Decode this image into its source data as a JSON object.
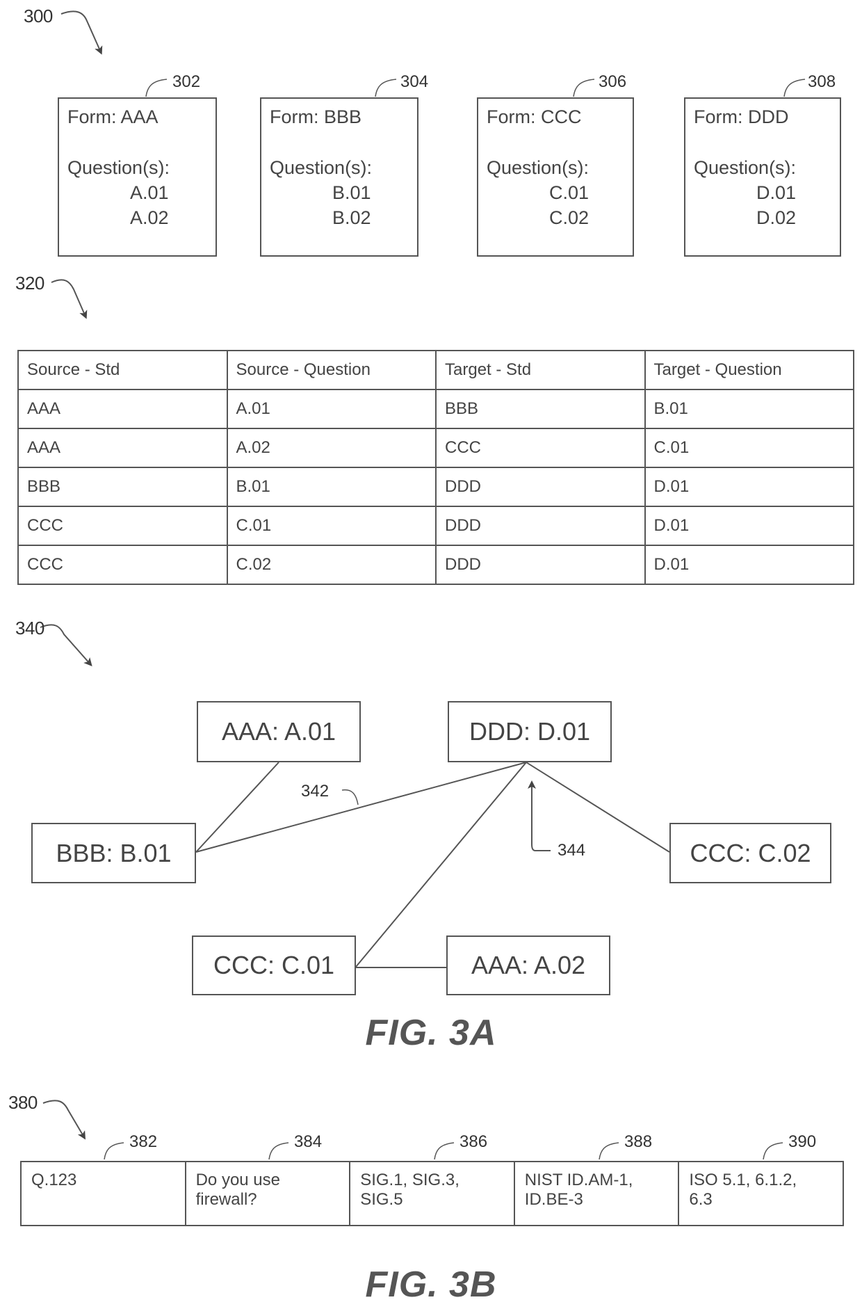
{
  "figure_refs": {
    "fig_300": "300",
    "fig_320": "320",
    "fig_340": "340",
    "fig_380": "380"
  },
  "forms": [
    {
      "ref": "302",
      "title": "Form: AAA",
      "questions_label": "Question(s):",
      "questions": [
        "A.01",
        "A.02"
      ]
    },
    {
      "ref": "304",
      "title": "Form: BBB",
      "questions_label": "Question(s):",
      "questions": [
        "B.01",
        "B.02"
      ]
    },
    {
      "ref": "306",
      "title": "Form: CCC",
      "questions_label": "Question(s):",
      "questions": [
        "C.01",
        "C.02"
      ]
    },
    {
      "ref": "308",
      "title": "Form: DDD",
      "questions_label": "Question(s):",
      "questions": [
        "D.01",
        "D.02"
      ]
    }
  ],
  "mapping_table": {
    "headers": [
      "Source - Std",
      "Source - Question",
      "Target - Std",
      "Target - Question"
    ],
    "rows": [
      [
        "AAA",
        "A.01",
        "BBB",
        "B.01"
      ],
      [
        "AAA",
        "A.02",
        "CCC",
        "C.01"
      ],
      [
        "BBB",
        "B.01",
        "DDD",
        "D.01"
      ],
      [
        "CCC",
        "C.01",
        "DDD",
        "D.01"
      ],
      [
        "CCC",
        "C.02",
        "DDD",
        "D.01"
      ]
    ]
  },
  "graph": {
    "nodes": {
      "aaa_a01": "AAA: A.01",
      "ddd_d01": "DDD: D.01",
      "bbb_b01": "BBB: B.01",
      "ccc_c02": "CCC: C.02",
      "ccc_c01": "CCC: C.01",
      "aaa_a02": "AAA: A.02"
    },
    "edges": [
      [
        "aaa_a01",
        "bbb_b01"
      ],
      [
        "bbb_b01",
        "ddd_d01"
      ],
      [
        "ccc_c01",
        "ddd_d01"
      ],
      [
        "ccc_c02",
        "ddd_d01"
      ],
      [
        "ccc_c01",
        "aaa_a02"
      ]
    ],
    "edge_ref": "342",
    "node_ref": "344"
  },
  "fig_3a_caption": "FIG. 3A",
  "record_row": {
    "refs": [
      "382",
      "384",
      "386",
      "388",
      "390"
    ],
    "cells": [
      [
        "Q.123"
      ],
      [
        "Do you use",
        "firewall?"
      ],
      [
        "SIG.1, SIG.3,",
        "SIG.5"
      ],
      [
        "NIST ID.AM-1,",
        "ID.BE-3"
      ],
      [
        "ISO 5.1, 6.1.2,",
        "6.3"
      ]
    ]
  },
  "fig_3b_caption": "FIG. 3B"
}
